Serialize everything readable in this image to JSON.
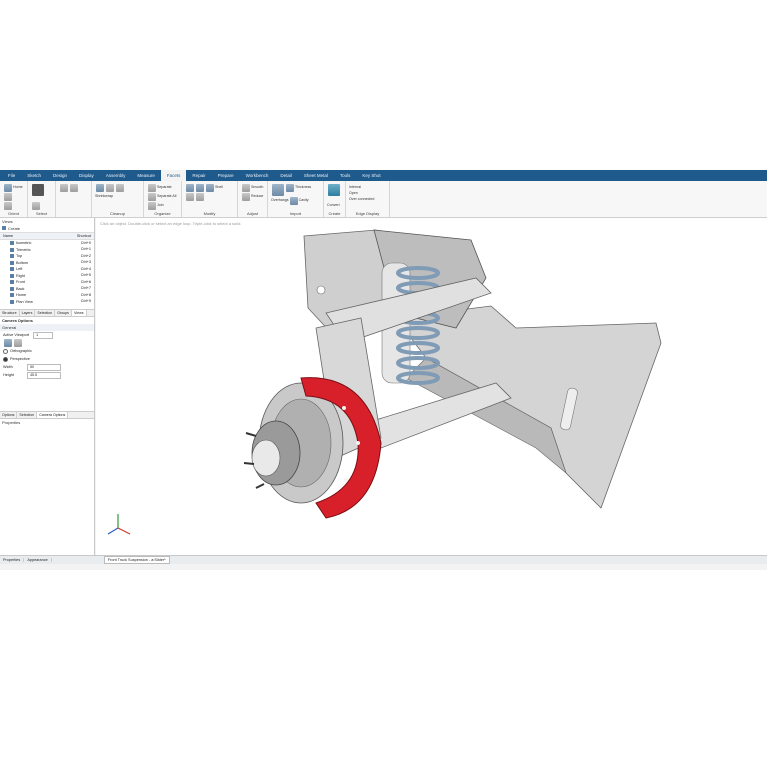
{
  "menu": [
    "File",
    "Sketch",
    "Design",
    "Display",
    "Assembly",
    "Measure",
    "Facets",
    "Repair",
    "Prepare",
    "Workbench",
    "Detail",
    "Sheet Metal",
    "Tools",
    "Key Shot"
  ],
  "menu_active": "Facets",
  "ribbon": {
    "orient": {
      "label": "Orient",
      "items": [
        "Home"
      ]
    },
    "select": {
      "label": "Select",
      "items": [
        "Select"
      ]
    },
    "cleanup": {
      "label": "Cleanup",
      "items": [
        "Shrinkwrap"
      ]
    },
    "organize": {
      "label": "Organize",
      "items": [
        "Separate",
        "Separate All",
        "Join"
      ]
    },
    "modify": {
      "label": "Modify",
      "items": [
        "Shell"
      ]
    },
    "adjust": {
      "label": "Adjust",
      "items": [
        "Smooth",
        "Reduce"
      ]
    },
    "import": {
      "label": "Import",
      "items": [
        "Overhangs",
        "Thickness",
        "Cavity"
      ]
    },
    "create": {
      "label": "Create",
      "items": [
        "Convert"
      ]
    },
    "edge_display": {
      "label": "Edge Display",
      "items": [
        "Internal",
        "Open",
        "Over connected"
      ]
    }
  },
  "views_panel": {
    "title": "Views",
    "create": "Create",
    "header_name": "Name",
    "header_shortcut": "Shortcut",
    "rows": [
      {
        "name": "Isometric",
        "shortcut": "Ctrl+0"
      },
      {
        "name": "Trimetric",
        "shortcut": "Ctrl+1"
      },
      {
        "name": "Top",
        "shortcut": "Ctrl+2"
      },
      {
        "name": "Bottom",
        "shortcut": "Ctrl+3"
      },
      {
        "name": "Left",
        "shortcut": "Ctrl+4"
      },
      {
        "name": "Right",
        "shortcut": "Ctrl+5"
      },
      {
        "name": "Front",
        "shortcut": "Ctrl+6"
      },
      {
        "name": "Back",
        "shortcut": "Ctrl+7"
      },
      {
        "name": "Home",
        "shortcut": "Ctrl+8"
      },
      {
        "name": "Plan View",
        "shortcut": "Ctrl+9"
      }
    ]
  },
  "panel_tabs": [
    "Structure",
    "Layers",
    "Selection",
    "Groups",
    "Views"
  ],
  "panel_tabs_active": "Views",
  "camera": {
    "title": "Camera Options",
    "general": "General",
    "active_viewport_label": "Active Viewport",
    "active_viewport_value": "1",
    "orthographic": "Orthographic",
    "perspective": "Perspective",
    "width_label": "Width",
    "width_value": "50",
    "height_label": "Height",
    "height_value": "45.5"
  },
  "options_tabs": [
    "Options",
    "Selection",
    "Camera Options"
  ],
  "properties_title": "Properties",
  "viewport_hint": "Click an object. Double-click or select an edge loop. Triple-click to select a solid.",
  "status": {
    "tabs": [
      "Properties",
      "Appearance"
    ],
    "field": "Front Truck Suspension - a:Slider*"
  },
  "colors": {
    "accent": "#1f5a8c",
    "caliper": "#d8202a"
  }
}
